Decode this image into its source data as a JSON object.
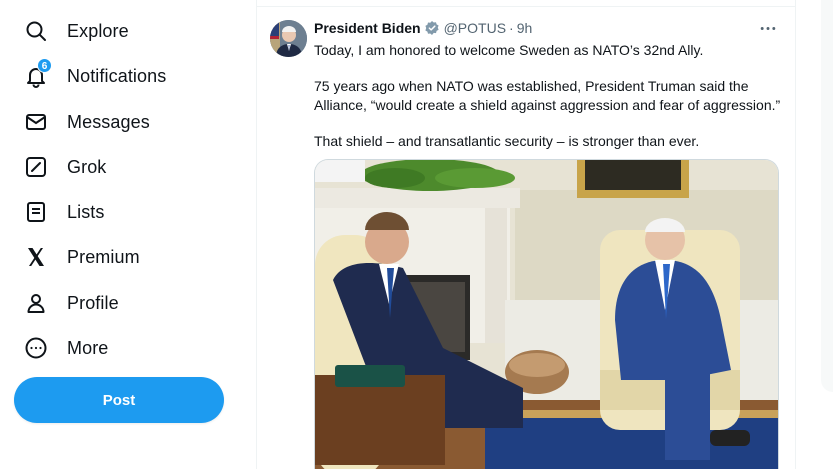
{
  "sidebar": {
    "items": [
      {
        "label": "Explore",
        "icon": "search-icon"
      },
      {
        "label": "Notifications",
        "icon": "bell-icon",
        "badge": "6"
      },
      {
        "label": "Messages",
        "icon": "envelope-icon"
      },
      {
        "label": "Grok",
        "icon": "grok-icon"
      },
      {
        "label": "Lists",
        "icon": "list-icon"
      },
      {
        "label": "Premium",
        "icon": "x-logo-icon"
      },
      {
        "label": "Profile",
        "icon": "person-icon"
      },
      {
        "label": "More",
        "icon": "more-circle-icon"
      }
    ],
    "post_label": "Post"
  },
  "tweet": {
    "author_name": "President Biden",
    "handle": "@POTUS",
    "separator": "·",
    "time": "9h",
    "paragraphs": [
      "Today, I am honored to welcome Sweden as NATO’s 32nd Ally.",
      "75 years ago when NATO was established, President Truman said the Alliance, “would create a shield against aggression and fear of aggression.”",
      "That shield – and transatlantic security – is stronger than ever."
    ],
    "media_icon": "photo"
  },
  "colors": {
    "accent": "#1d9bf0",
    "text": "#0f1419",
    "muted": "#536471",
    "border": "#eff3f4"
  }
}
